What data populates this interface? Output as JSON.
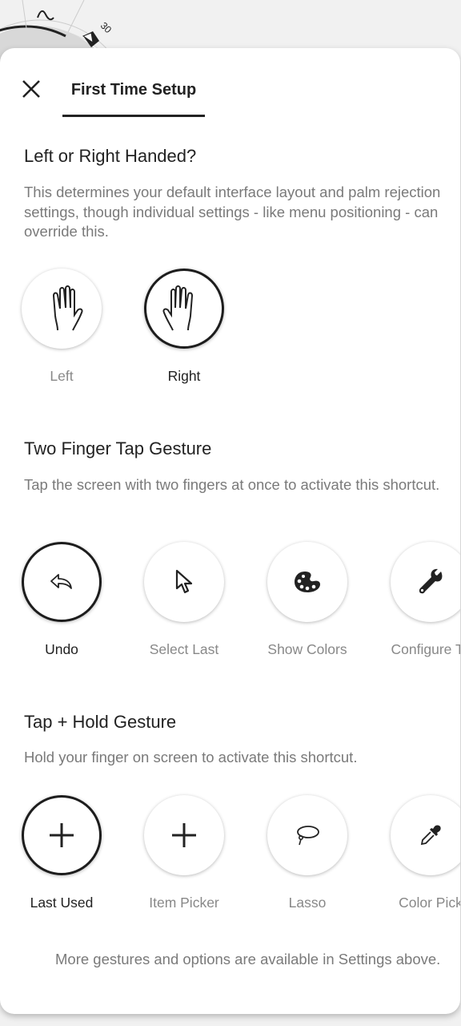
{
  "background": {
    "dial_label": "30"
  },
  "header": {
    "tab_label": "First Time Setup",
    "close_icon": "close-icon"
  },
  "handedness": {
    "title": "Left or Right Handed?",
    "description": "This determines your default interface layout and palm rejection settings, though individual settings - like menu positioning - can override this.",
    "options": [
      {
        "label": "Left",
        "icon": "hand-icon",
        "selected": false
      },
      {
        "label": "Right",
        "icon": "hand-icon",
        "selected": true
      }
    ]
  },
  "two_finger": {
    "title": "Two Finger Tap Gesture",
    "description": "Tap the screen with two fingers at once to activate this shortcut.",
    "options": [
      {
        "label": "Undo",
        "icon": "undo-icon",
        "selected": true
      },
      {
        "label": "Select Last",
        "icon": "pointer-icon",
        "selected": false
      },
      {
        "label": "Show Colors",
        "icon": "palette-icon",
        "selected": false
      },
      {
        "label": "Configure To",
        "icon": "wrench-icon",
        "selected": false
      }
    ]
  },
  "tap_hold": {
    "title": "Tap + Hold Gesture",
    "description": "Hold your finger on screen to activate this shortcut.",
    "options": [
      {
        "label": "Last Used",
        "icon": "plus-icon",
        "selected": true
      },
      {
        "label": "Item Picker",
        "icon": "plus-icon",
        "selected": false
      },
      {
        "label": "Lasso",
        "icon": "lasso-icon",
        "selected": false
      },
      {
        "label": "Color Pick",
        "icon": "eyedropper-icon",
        "selected": false
      }
    ]
  },
  "footer": {
    "note": "More gestures and options are available in Settings above."
  },
  "colors": {
    "accent": "#1d1d1d",
    "muted_text": "#7a7a7a",
    "background": "#f1f1f1"
  }
}
